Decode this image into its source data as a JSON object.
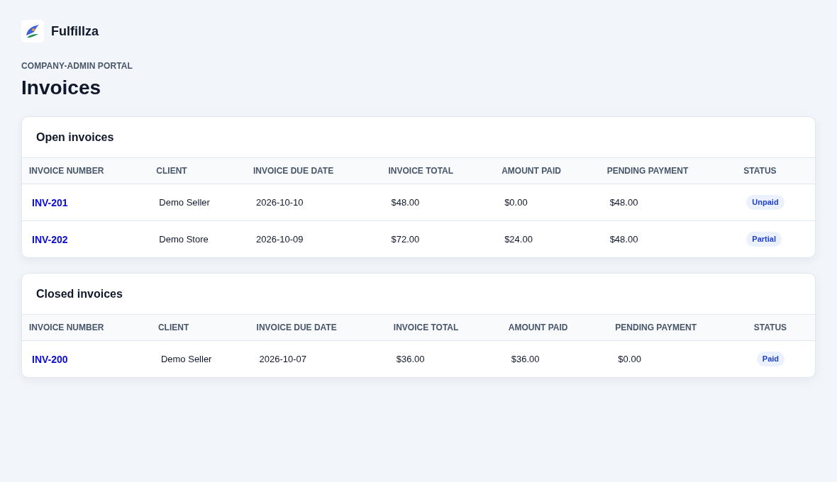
{
  "brand": {
    "name": "Fulfillza"
  },
  "header": {
    "eyebrow": "COMPANY-ADMIN PORTAL",
    "title": "Invoices"
  },
  "sections": [
    {
      "title": "Open invoices",
      "table": {
        "columns": [
          "INVOICE NUMBER",
          "CLIENT",
          "INVOICE DUE DATE",
          "INVOICE TOTAL",
          "AMOUNT PAID",
          "PENDING PAYMENT",
          "STATUS"
        ],
        "rows": [
          {
            "invoice_number": "INV-201",
            "client": "Demo Seller",
            "due_date": "2026-10-10",
            "total": "$48.00",
            "amount_paid": "$0.00",
            "pending_payment": "$48.00",
            "status": "Unpaid"
          },
          {
            "invoice_number": "INV-202",
            "client": "Demo Store",
            "due_date": "2026-10-09",
            "total": "$72.00",
            "amount_paid": "$24.00",
            "pending_payment": "$48.00",
            "status": "Partial"
          }
        ]
      }
    },
    {
      "title": "Closed invoices",
      "table": {
        "columns": [
          "INVOICE NUMBER",
          "CLIENT",
          "INVOICE DUE DATE",
          "INVOICE TOTAL",
          "AMOUNT PAID",
          "PENDING PAYMENT",
          "STATUS"
        ],
        "rows": [
          {
            "invoice_number": "INV-200",
            "client": "Demo Seller",
            "due_date": "2026-10-07",
            "total": "$36.00",
            "amount_paid": "$36.00",
            "pending_payment": "$0.00",
            "status": "Paid"
          }
        ]
      }
    }
  ]
}
